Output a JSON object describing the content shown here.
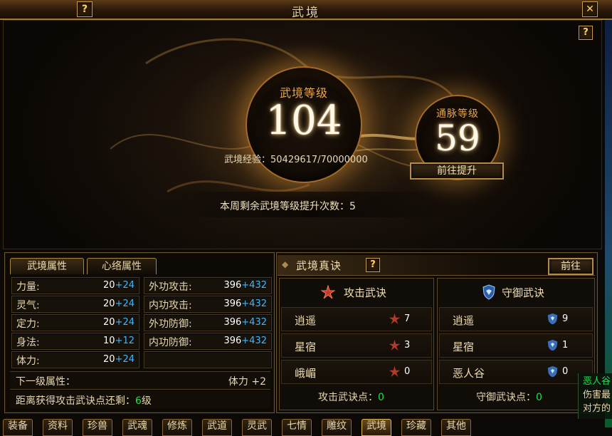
{
  "window": {
    "title": "武境",
    "help_glyph": "?",
    "close_glyph": "✕"
  },
  "hero": {
    "level_label": "武境等级",
    "level_value": "104",
    "exp_label": "武境经验：",
    "exp_value": "50429617/70000000",
    "pulse_label": "通脉等级",
    "pulse_value": "59",
    "goto_upgrade_label": "前往提升",
    "weekly_text": "本周剩余武境等级提升次数：",
    "weekly_count": "5"
  },
  "left_panel": {
    "tabs": [
      {
        "label": "武境属性",
        "active": true
      },
      {
        "label": "心络属性",
        "active": false
      }
    ],
    "attributes_left": [
      {
        "label": "力量:",
        "base": "20",
        "bonus": "+24"
      },
      {
        "label": "灵气:",
        "base": "20",
        "bonus": "+24"
      },
      {
        "label": "定力:",
        "base": "20",
        "bonus": "+24"
      },
      {
        "label": "身法:",
        "base": "10",
        "bonus": "+12"
      },
      {
        "label": "体力:",
        "base": "20",
        "bonus": "+24"
      }
    ],
    "attributes_right": [
      {
        "label": "外功攻击:",
        "base": "396",
        "bonus": "+432"
      },
      {
        "label": "内功攻击:",
        "base": "396",
        "bonus": "+432"
      },
      {
        "label": "外功防御:",
        "base": "396",
        "bonus": "+432"
      },
      {
        "label": "内功防御:",
        "base": "396",
        "bonus": "+432"
      }
    ],
    "next_level_label": "下一级属性：",
    "next_level_value": "体力 +2",
    "distance_label": "距离获得攻击武诀点还剩：",
    "distance_value": "6",
    "distance_unit": "级"
  },
  "right_panel": {
    "title": "武境真诀",
    "help_glyph": "?",
    "goto_label": "前往",
    "attack": {
      "title": "攻击武诀",
      "items": [
        {
          "name": "逍遥",
          "count": "7"
        },
        {
          "name": "星宿",
          "count": "3"
        },
        {
          "name": "峨嵋",
          "count": "0"
        }
      ],
      "points_label": "攻击武诀点：",
      "points_value": "0"
    },
    "defense": {
      "title": "守御武诀",
      "items": [
        {
          "name": "逍遥",
          "count": "9"
        },
        {
          "name": "星宿",
          "count": "1"
        },
        {
          "name": "恶人谷",
          "count": "0"
        }
      ],
      "points_label": "守御武诀点：",
      "points_value": "0"
    }
  },
  "bottom_tabs": [
    "装备",
    "资料",
    "珍兽",
    "武魂",
    "修炼",
    "武道",
    "灵武",
    "七情",
    "雕纹",
    "武境",
    "珍藏",
    "其他"
  ],
  "chat": [
    "恶人谷",
    "伤害最",
    "对方的"
  ],
  "colors": {
    "accent_gold": "#c89b4a",
    "bonus_blue": "#3fb6ff",
    "highlight_green": "#22e04a"
  }
}
